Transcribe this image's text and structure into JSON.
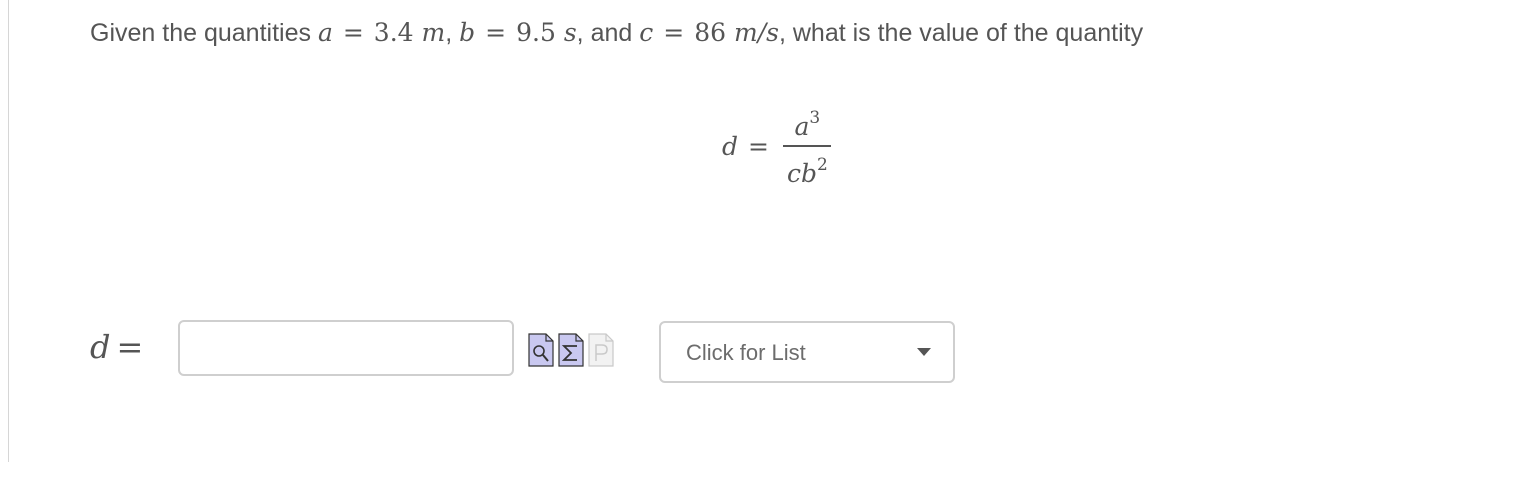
{
  "question": {
    "prefix": "Given the quantities",
    "a_symbol": "a",
    "a_value": "3.4",
    "a_unit": "m",
    "b_symbol": "b",
    "b_value": "9.5",
    "b_unit": "s",
    "and": "and",
    "c_symbol": "c",
    "c_value": "86",
    "c_unit": "m/s",
    "suffix": "what is the value of the quantity"
  },
  "formula": {
    "lhs": "d",
    "eq": "=",
    "numerator_var": "a",
    "numerator_exp": "3",
    "denominator_var": "cb",
    "denominator_exp": "2"
  },
  "answer": {
    "label_var": "d",
    "label_eq": "=",
    "input_value": "",
    "input_placeholder": ""
  },
  "tools": [
    {
      "icon": "preview-icon",
      "enabled": true
    },
    {
      "icon": "sigma-equation-icon",
      "enabled": true
    },
    {
      "icon": "p-document-icon",
      "enabled": false
    }
  ],
  "select": {
    "label": "Click for List"
  },
  "colors": {
    "text": "#555555",
    "border": "#cfcfcf",
    "tool_fill": "#c9c8f0",
    "tool_fill_disabled": "#e6e6e6"
  }
}
